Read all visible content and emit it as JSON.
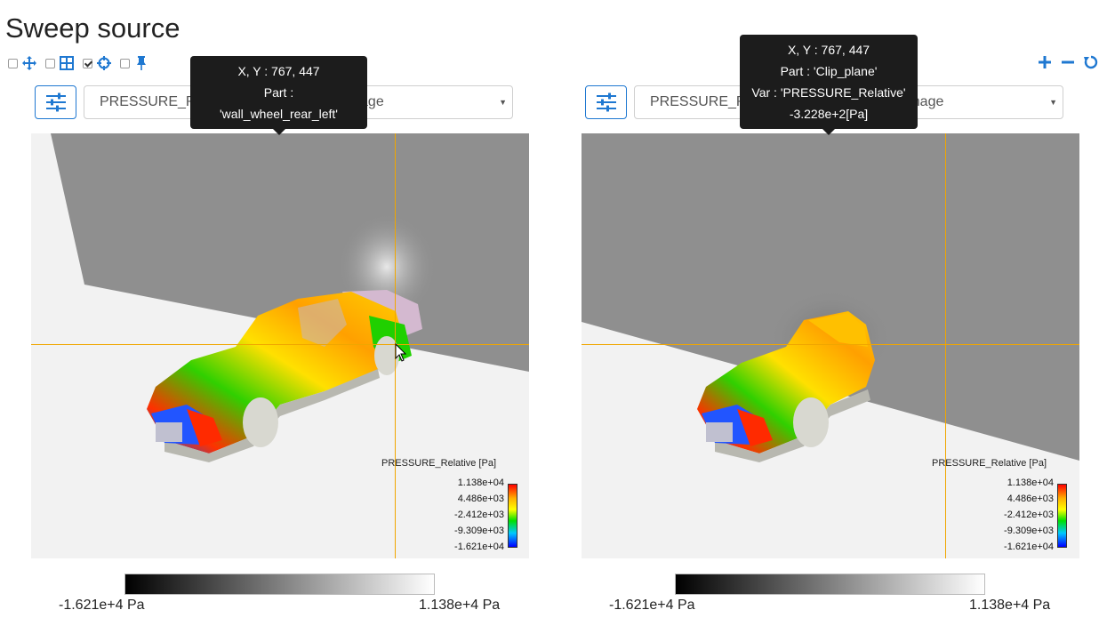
{
  "page": {
    "title": "Sweep source"
  },
  "toolbar": {
    "items": [
      {
        "checked": false,
        "icon": "move-arrows-icon"
      },
      {
        "checked": false,
        "icon": "grid-icon"
      },
      {
        "checked": true,
        "icon": "crosshair-icon"
      },
      {
        "checked": false,
        "icon": "pin-icon"
      }
    ],
    "right_actions": [
      "zoom-in-icon",
      "zoom-out-icon",
      "reset-icon"
    ],
    "accent": "#1f78d1"
  },
  "left": {
    "variable": "PRESSURE_Relative",
    "image_label": "Left image",
    "legend_title": "PRESSURE_Relative [Pa]",
    "legend_ticks": [
      "1.138e+04",
      "4.486e+03",
      "-2.412e+03",
      "-9.309e+03",
      "-1.621e+04"
    ],
    "gray_min": "-1.621e+4  Pa",
    "gray_max": "1.138e+4  Pa",
    "tooltip": {
      "line1": "X, Y : 767, 447",
      "line2": "Part :",
      "line3": "'wall_wheel_rear_left'"
    }
  },
  "right": {
    "variable": "PRESSURE_Relative",
    "image_label": "Right image",
    "legend_title": "PRESSURE_Relative [Pa]",
    "legend_ticks": [
      "1.138e+04",
      "4.486e+03",
      "-2.412e+03",
      "-9.309e+03",
      "-1.621e+04"
    ],
    "gray_min": "-1.621e+4  Pa",
    "gray_max": "1.138e+4  Pa",
    "tooltip": {
      "line1": "X, Y : 767, 447",
      "line2": "Part : 'Clip_plane'",
      "line3": "Var : 'PRESSURE_Relative'",
      "line4": "-3.228e+2[Pa]"
    }
  },
  "colors": {
    "crosshair": "#f0a600",
    "background_wall": "#8f8f8f",
    "floor": "#f2f2f2"
  }
}
